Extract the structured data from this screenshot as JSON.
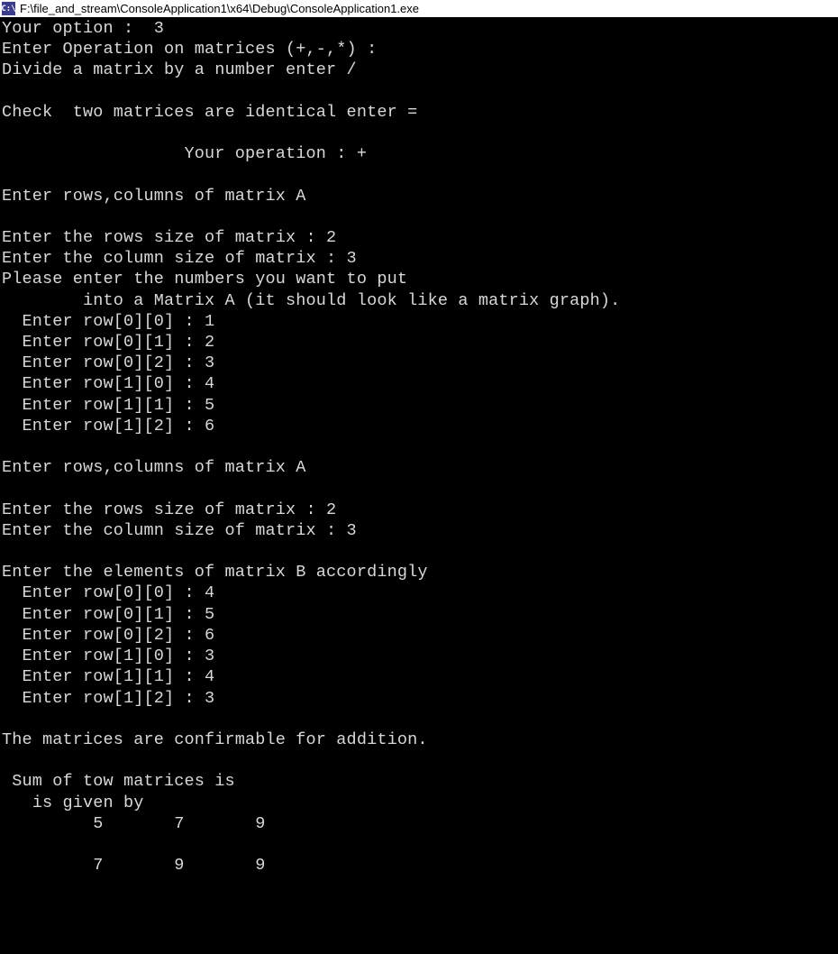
{
  "window": {
    "title": "F:\\file_and_stream\\ConsoleApplication1\\x64\\Debug\\ConsoleApplication1.exe",
    "icon_label": "C:\\"
  },
  "console": {
    "lines": [
      "Your option :  3",
      "Enter Operation on matrices (+,-,*) :",
      "Divide a matrix by a number enter /",
      "",
      "Check  two matrices are identical enter =",
      "",
      "                  Your operation : +",
      "",
      "Enter rows,columns of matrix A",
      "",
      "Enter the rows size of matrix : 2",
      "Enter the column size of matrix : 3",
      "Please enter the numbers you want to put",
      "        into a Matrix A (it should look like a matrix graph).",
      "  Enter row[0][0] : 1",
      "  Enter row[0][1] : 2",
      "  Enter row[0][2] : 3",
      "  Enter row[1][0] : 4",
      "  Enter row[1][1] : 5",
      "  Enter row[1][2] : 6",
      "",
      "Enter rows,columns of matrix A",
      "",
      "Enter the rows size of matrix : 2",
      "Enter the column size of matrix : 3",
      "",
      "Enter the elements of matrix B accordingly",
      "  Enter row[0][0] : 4",
      "  Enter row[0][1] : 5",
      "  Enter row[0][2] : 6",
      "  Enter row[1][0] : 3",
      "  Enter row[1][1] : 4",
      "  Enter row[1][2] : 3",
      "",
      "The matrices are confirmable for addition.",
      "",
      " Sum of tow matrices is",
      "   is given by",
      "         5       7       9",
      "",
      "         7       9       9"
    ]
  }
}
